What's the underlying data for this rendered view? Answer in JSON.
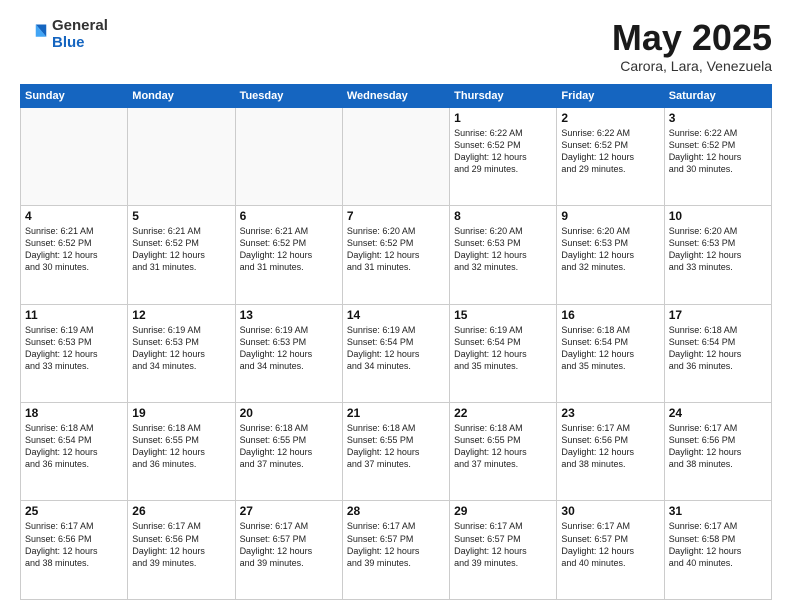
{
  "logo": {
    "general": "General",
    "blue": "Blue"
  },
  "title": {
    "month_year": "May 2025",
    "location": "Carora, Lara, Venezuela"
  },
  "headers": [
    "Sunday",
    "Monday",
    "Tuesday",
    "Wednesday",
    "Thursday",
    "Friday",
    "Saturday"
  ],
  "weeks": [
    [
      {
        "day": "",
        "info": ""
      },
      {
        "day": "",
        "info": ""
      },
      {
        "day": "",
        "info": ""
      },
      {
        "day": "",
        "info": ""
      },
      {
        "day": "1",
        "info": "Sunrise: 6:22 AM\nSunset: 6:52 PM\nDaylight: 12 hours\nand 29 minutes."
      },
      {
        "day": "2",
        "info": "Sunrise: 6:22 AM\nSunset: 6:52 PM\nDaylight: 12 hours\nand 29 minutes."
      },
      {
        "day": "3",
        "info": "Sunrise: 6:22 AM\nSunset: 6:52 PM\nDaylight: 12 hours\nand 30 minutes."
      }
    ],
    [
      {
        "day": "4",
        "info": "Sunrise: 6:21 AM\nSunset: 6:52 PM\nDaylight: 12 hours\nand 30 minutes."
      },
      {
        "day": "5",
        "info": "Sunrise: 6:21 AM\nSunset: 6:52 PM\nDaylight: 12 hours\nand 31 minutes."
      },
      {
        "day": "6",
        "info": "Sunrise: 6:21 AM\nSunset: 6:52 PM\nDaylight: 12 hours\nand 31 minutes."
      },
      {
        "day": "7",
        "info": "Sunrise: 6:20 AM\nSunset: 6:52 PM\nDaylight: 12 hours\nand 31 minutes."
      },
      {
        "day": "8",
        "info": "Sunrise: 6:20 AM\nSunset: 6:53 PM\nDaylight: 12 hours\nand 32 minutes."
      },
      {
        "day": "9",
        "info": "Sunrise: 6:20 AM\nSunset: 6:53 PM\nDaylight: 12 hours\nand 32 minutes."
      },
      {
        "day": "10",
        "info": "Sunrise: 6:20 AM\nSunset: 6:53 PM\nDaylight: 12 hours\nand 33 minutes."
      }
    ],
    [
      {
        "day": "11",
        "info": "Sunrise: 6:19 AM\nSunset: 6:53 PM\nDaylight: 12 hours\nand 33 minutes."
      },
      {
        "day": "12",
        "info": "Sunrise: 6:19 AM\nSunset: 6:53 PM\nDaylight: 12 hours\nand 34 minutes."
      },
      {
        "day": "13",
        "info": "Sunrise: 6:19 AM\nSunset: 6:53 PM\nDaylight: 12 hours\nand 34 minutes."
      },
      {
        "day": "14",
        "info": "Sunrise: 6:19 AM\nSunset: 6:54 PM\nDaylight: 12 hours\nand 34 minutes."
      },
      {
        "day": "15",
        "info": "Sunrise: 6:19 AM\nSunset: 6:54 PM\nDaylight: 12 hours\nand 35 minutes."
      },
      {
        "day": "16",
        "info": "Sunrise: 6:18 AM\nSunset: 6:54 PM\nDaylight: 12 hours\nand 35 minutes."
      },
      {
        "day": "17",
        "info": "Sunrise: 6:18 AM\nSunset: 6:54 PM\nDaylight: 12 hours\nand 36 minutes."
      }
    ],
    [
      {
        "day": "18",
        "info": "Sunrise: 6:18 AM\nSunset: 6:54 PM\nDaylight: 12 hours\nand 36 minutes."
      },
      {
        "day": "19",
        "info": "Sunrise: 6:18 AM\nSunset: 6:55 PM\nDaylight: 12 hours\nand 36 minutes."
      },
      {
        "day": "20",
        "info": "Sunrise: 6:18 AM\nSunset: 6:55 PM\nDaylight: 12 hours\nand 37 minutes."
      },
      {
        "day": "21",
        "info": "Sunrise: 6:18 AM\nSunset: 6:55 PM\nDaylight: 12 hours\nand 37 minutes."
      },
      {
        "day": "22",
        "info": "Sunrise: 6:18 AM\nSunset: 6:55 PM\nDaylight: 12 hours\nand 37 minutes."
      },
      {
        "day": "23",
        "info": "Sunrise: 6:17 AM\nSunset: 6:56 PM\nDaylight: 12 hours\nand 38 minutes."
      },
      {
        "day": "24",
        "info": "Sunrise: 6:17 AM\nSunset: 6:56 PM\nDaylight: 12 hours\nand 38 minutes."
      }
    ],
    [
      {
        "day": "25",
        "info": "Sunrise: 6:17 AM\nSunset: 6:56 PM\nDaylight: 12 hours\nand 38 minutes."
      },
      {
        "day": "26",
        "info": "Sunrise: 6:17 AM\nSunset: 6:56 PM\nDaylight: 12 hours\nand 39 minutes."
      },
      {
        "day": "27",
        "info": "Sunrise: 6:17 AM\nSunset: 6:57 PM\nDaylight: 12 hours\nand 39 minutes."
      },
      {
        "day": "28",
        "info": "Sunrise: 6:17 AM\nSunset: 6:57 PM\nDaylight: 12 hours\nand 39 minutes."
      },
      {
        "day": "29",
        "info": "Sunrise: 6:17 AM\nSunset: 6:57 PM\nDaylight: 12 hours\nand 39 minutes."
      },
      {
        "day": "30",
        "info": "Sunrise: 6:17 AM\nSunset: 6:57 PM\nDaylight: 12 hours\nand 40 minutes."
      },
      {
        "day": "31",
        "info": "Sunrise: 6:17 AM\nSunset: 6:58 PM\nDaylight: 12 hours\nand 40 minutes."
      }
    ]
  ]
}
